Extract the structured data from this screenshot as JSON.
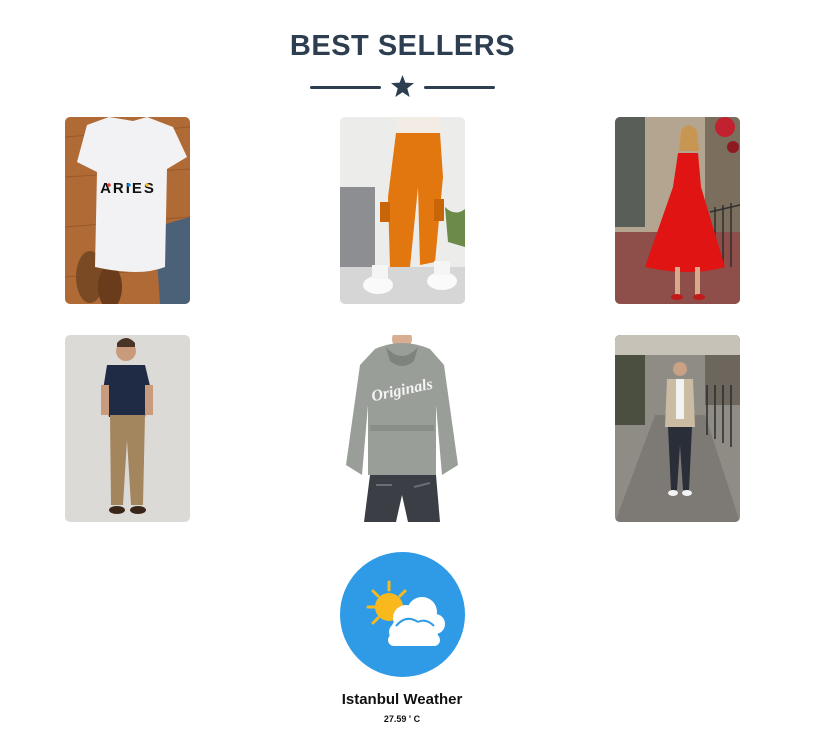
{
  "section": {
    "title": "BEST SELLERS",
    "divider_icon": "star-icon"
  },
  "products": [
    {
      "name": "white-aries-tshirt",
      "print_text": "ARIES"
    },
    {
      "name": "orange-cargo-pants"
    },
    {
      "name": "red-dress"
    },
    {
      "name": "navy-polo-khaki-outfit"
    },
    {
      "name": "grey-originals-hoodie",
      "print_text": "Originals"
    },
    {
      "name": "beige-blazer-outfit"
    }
  ],
  "weather": {
    "icon": "partly-cloudy-icon",
    "title": "Istanbul Weather",
    "temperature": "27.59 ' C"
  },
  "colors": {
    "heading": "#2c3e50",
    "weather_bg": "#2f9ae6",
    "sun": "#f9b91d"
  }
}
